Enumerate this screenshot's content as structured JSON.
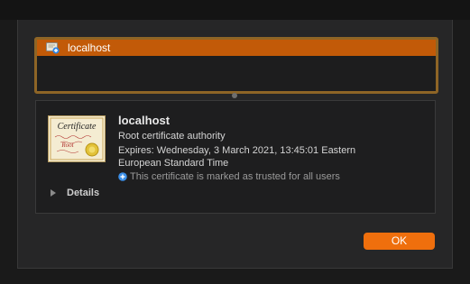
{
  "certificate_list": {
    "items": [
      {
        "label": "localhost",
        "icon": "certificate-plus-icon",
        "selected": true
      }
    ]
  },
  "details": {
    "name": "localhost",
    "type": "Root certificate authority",
    "expires_line1": "Expires: Wednesday, 3 March 2021, 13:45:01 Eastern",
    "expires_line2": "European Standard Time",
    "trust_message": "This certificate is marked as trusted for all users",
    "details_label": "Details",
    "image_title": "Certificate",
    "image_subtitle": "Root"
  },
  "buttons": {
    "ok_label": "OK"
  },
  "colors": {
    "accent": "#ef6f0d",
    "selection": "#c25a08",
    "focus_ring": "#8e6526",
    "trust_icon": "#3b8fe8"
  }
}
